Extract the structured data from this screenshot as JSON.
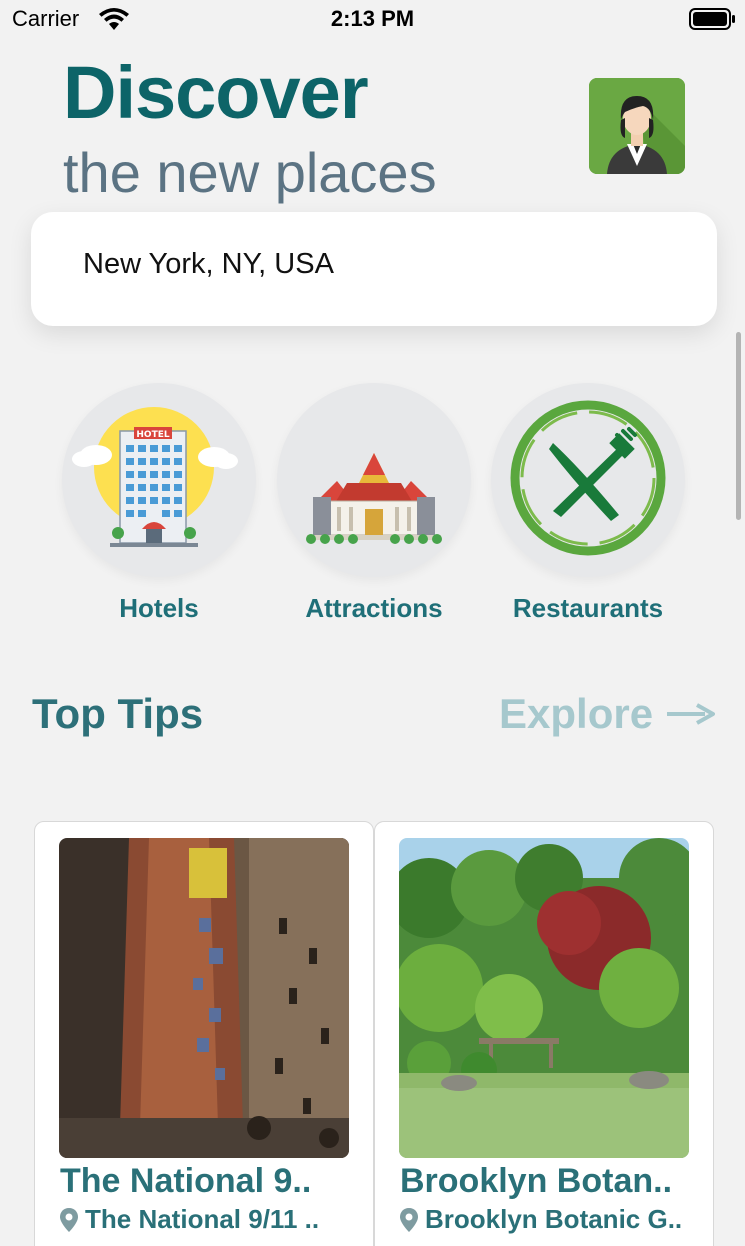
{
  "status_bar": {
    "carrier": "Carrier",
    "time": "2:13 PM"
  },
  "header": {
    "title": "Discover",
    "subtitle": "the new places"
  },
  "search": {
    "location": "New York, NY, USA"
  },
  "categories": [
    {
      "label": "Hotels",
      "icon": "hotel-icon"
    },
    {
      "label": "Attractions",
      "icon": "temple-icon"
    },
    {
      "label": "Restaurants",
      "icon": "fork-knife-icon"
    }
  ],
  "section": {
    "title": "Top Tips",
    "explore_label": "Explore"
  },
  "cards": [
    {
      "title": "The National 9..",
      "subtitle": "The National 9/11 ..",
      "icon": "location-pin-icon"
    },
    {
      "title": "Brooklyn Botan..",
      "subtitle": "Brooklyn Botanic G..",
      "icon": "location-pin-icon"
    }
  ],
  "colors": {
    "title": "#0d6468",
    "subtitle": "#5b7383",
    "accent": "#2d7079",
    "explore": "#a6c8cd",
    "background": "#f2f2f2"
  }
}
